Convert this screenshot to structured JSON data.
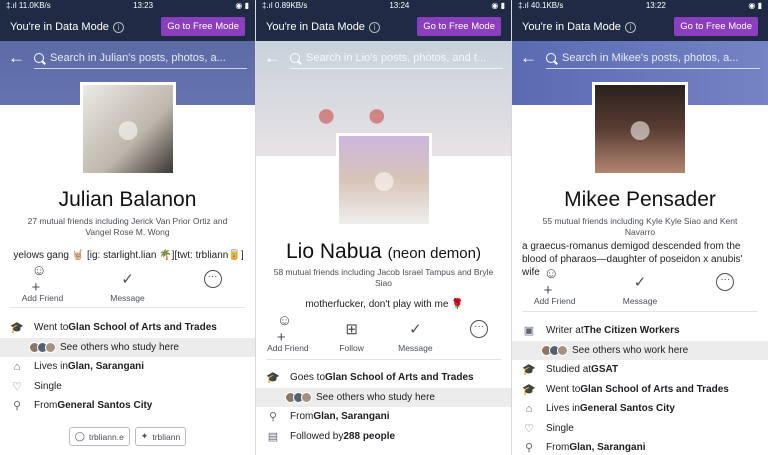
{
  "panels": [
    {
      "status": {
        "left": "‡.ıl 11.0KB/s",
        "time": "13:23",
        "right": "◉ ▮"
      },
      "data_mode": {
        "label": "You're in Data Mode",
        "button": "Go to Free Mode"
      },
      "search_placeholder": "Search in Julian's posts, photos, a...",
      "name": "Julian Balanon",
      "nickname": "",
      "mutual": "27 mutual friends including Jerick Van Prior Ortiz and Vangel Rose M. Wong",
      "bio": "yelows gang 🤘🏼 [ig: starlight.lian 🌴][twt: trbliann🥫]",
      "actions": [
        {
          "label": "Add Friend",
          "icon": "add-friend-icon"
        },
        {
          "label": "Message",
          "icon": "messenger-icon"
        },
        {
          "label": "",
          "icon": "more-icon"
        }
      ],
      "info": [
        {
          "icon": "graduation-cap-icon",
          "prefix": "Went to ",
          "bold": "Glan School of Arts and Trades",
          "suffix": ""
        },
        {
          "icon": "faces",
          "prefix": "See others who study here",
          "bold": "",
          "suffix": "",
          "highlight": true
        },
        {
          "icon": "home-icon",
          "prefix": "Lives in ",
          "bold": "Glan, Sarangani",
          "suffix": ""
        },
        {
          "icon": "heart-icon",
          "prefix": "Single",
          "bold": "",
          "suffix": ""
        },
        {
          "icon": "location-pin-icon",
          "prefix": "From ",
          "bold": "General Santos City",
          "suffix": ""
        }
      ],
      "social": [
        {
          "icon": "instagram-icon",
          "label": "trbliann.e"
        },
        {
          "icon": "twitter-icon",
          "label": "trbliann"
        }
      ]
    },
    {
      "status": {
        "left": "‡.ıl 0.89KB/s",
        "time": "13:24",
        "right": "◉ ▮"
      },
      "data_mode": {
        "label": "You're in Data Mode",
        "button": "Go to Free Mode"
      },
      "search_placeholder": "Search in Lio's posts, photos, and t...",
      "name": "Lio Nabua",
      "nickname": "(neon demon)",
      "mutual": "58 mutual friends including Jacob Israel Tampus and Bryle Siao",
      "bio": "motherfucker, don't play with me 🌹",
      "actions": [
        {
          "label": "Add Friend",
          "icon": "add-friend-icon"
        },
        {
          "label": "Follow",
          "icon": "follow-icon"
        },
        {
          "label": "Message",
          "icon": "messenger-icon"
        },
        {
          "label": "",
          "icon": "more-icon"
        }
      ],
      "info": [
        {
          "icon": "graduation-cap-icon",
          "prefix": "Goes to ",
          "bold": "Glan School of Arts and Trades",
          "suffix": ""
        },
        {
          "icon": "faces",
          "prefix": "See others who study here",
          "bold": "",
          "suffix": "",
          "highlight": true
        },
        {
          "icon": "location-pin-icon",
          "prefix": "From ",
          "bold": "Glan, Sarangani",
          "suffix": ""
        },
        {
          "icon": "followers-icon",
          "prefix": "Followed by ",
          "bold": "288 people",
          "suffix": ""
        }
      ]
    },
    {
      "status": {
        "left": "‡.ıl 40.1KB/s",
        "time": "13:22",
        "right": "◉ ▮"
      },
      "data_mode": {
        "label": "You're in Data Mode",
        "button": "Go to Free Mode"
      },
      "search_placeholder": "Search in Mikee's posts, photos, a...",
      "name": "Mikee Pensader",
      "nickname": "",
      "mutual": "55 mutual friends including Kyle Kyle Siao and Kent Navarro",
      "bio": "a graecus-romanus demigod descended from the blood of pharaos—daughter of poseidon x anubis' wife",
      "actions": [
        {
          "label": "Add Friend",
          "icon": "add-friend-icon"
        },
        {
          "label": "Message",
          "icon": "messenger-icon"
        },
        {
          "label": "",
          "icon": "more-icon"
        }
      ],
      "info": [
        {
          "icon": "briefcase-icon",
          "prefix": "Writer at ",
          "bold": "The Citizen Workers",
          "suffix": ""
        },
        {
          "icon": "faces",
          "prefix": "See others who work here",
          "bold": "",
          "suffix": "",
          "highlight": true
        },
        {
          "icon": "graduation-cap-icon",
          "prefix": "Studied at ",
          "bold": "GSAT",
          "suffix": ""
        },
        {
          "icon": "graduation-cap-icon",
          "prefix": "Went to ",
          "bold": "Glan School of Arts and Trades",
          "suffix": ""
        },
        {
          "icon": "home-icon",
          "prefix": "Lives in ",
          "bold": "General Santos City",
          "suffix": ""
        },
        {
          "icon": "heart-icon",
          "prefix": "Single",
          "bold": "",
          "suffix": ""
        },
        {
          "icon": "location-pin-icon",
          "prefix": "From ",
          "bold": "Glan, Sarangani",
          "suffix": ""
        }
      ]
    }
  ],
  "colors": {
    "top_bar": "#1f2a44",
    "free_button": "#8b3fbf",
    "highlight_row": "#ececec"
  }
}
